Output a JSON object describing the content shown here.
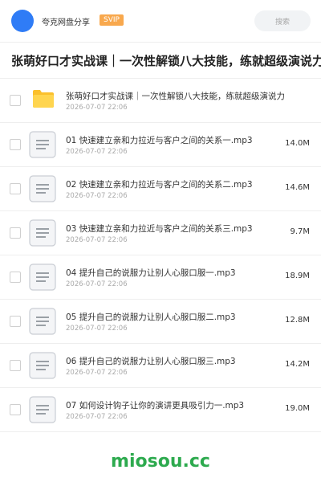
{
  "header": {
    "site_name": "夸克网盘分享",
    "badge": "SVIP",
    "search_placeholder": "搜索"
  },
  "share": {
    "title": "张萌好口才实战课｜一次性解锁八大技能，练就超级演说力"
  },
  "items": [
    {
      "type": "folder",
      "name": "张萌好口才实战课｜一次性解锁八大技能，练就超级演说力",
      "date": "2026-07-07 22:06",
      "size": ""
    },
    {
      "type": "file",
      "name": "01 快速建立亲和力拉近与客户之间的关系一.mp3",
      "date": "2026-07-07 22:06",
      "size": "14.0M"
    },
    {
      "type": "file",
      "name": "02 快速建立亲和力拉近与客户之间的关系二.mp3",
      "date": "2026-07-07 22:06",
      "size": "14.6M"
    },
    {
      "type": "file",
      "name": "03 快速建立亲和力拉近与客户之间的关系三.mp3",
      "date": "2026-07-07 22:06",
      "size": "9.7M"
    },
    {
      "type": "file",
      "name": "04 提升自己的说服力让别人心服口服一.mp3",
      "date": "2026-07-07 22:06",
      "size": "18.9M"
    },
    {
      "type": "file",
      "name": "05 提升自己的说服力让别人心服口服二.mp3",
      "date": "2026-07-07 22:06",
      "size": "12.8M"
    },
    {
      "type": "file",
      "name": "06 提升自己的说服力让别人心服口服三.mp3",
      "date": "2026-07-07 22:06",
      "size": "14.2M"
    },
    {
      "type": "file",
      "name": "07 如何设计钩子让你的演讲更具吸引力一.mp3",
      "date": "2026-07-07 22:06",
      "size": "19.0M"
    }
  ],
  "watermark": "miosou.cc",
  "colors": {
    "accent": "#2f7cf6",
    "badge": "#f8a84d",
    "folder": "#fbc02d",
    "watermark": "#2daa4e"
  }
}
